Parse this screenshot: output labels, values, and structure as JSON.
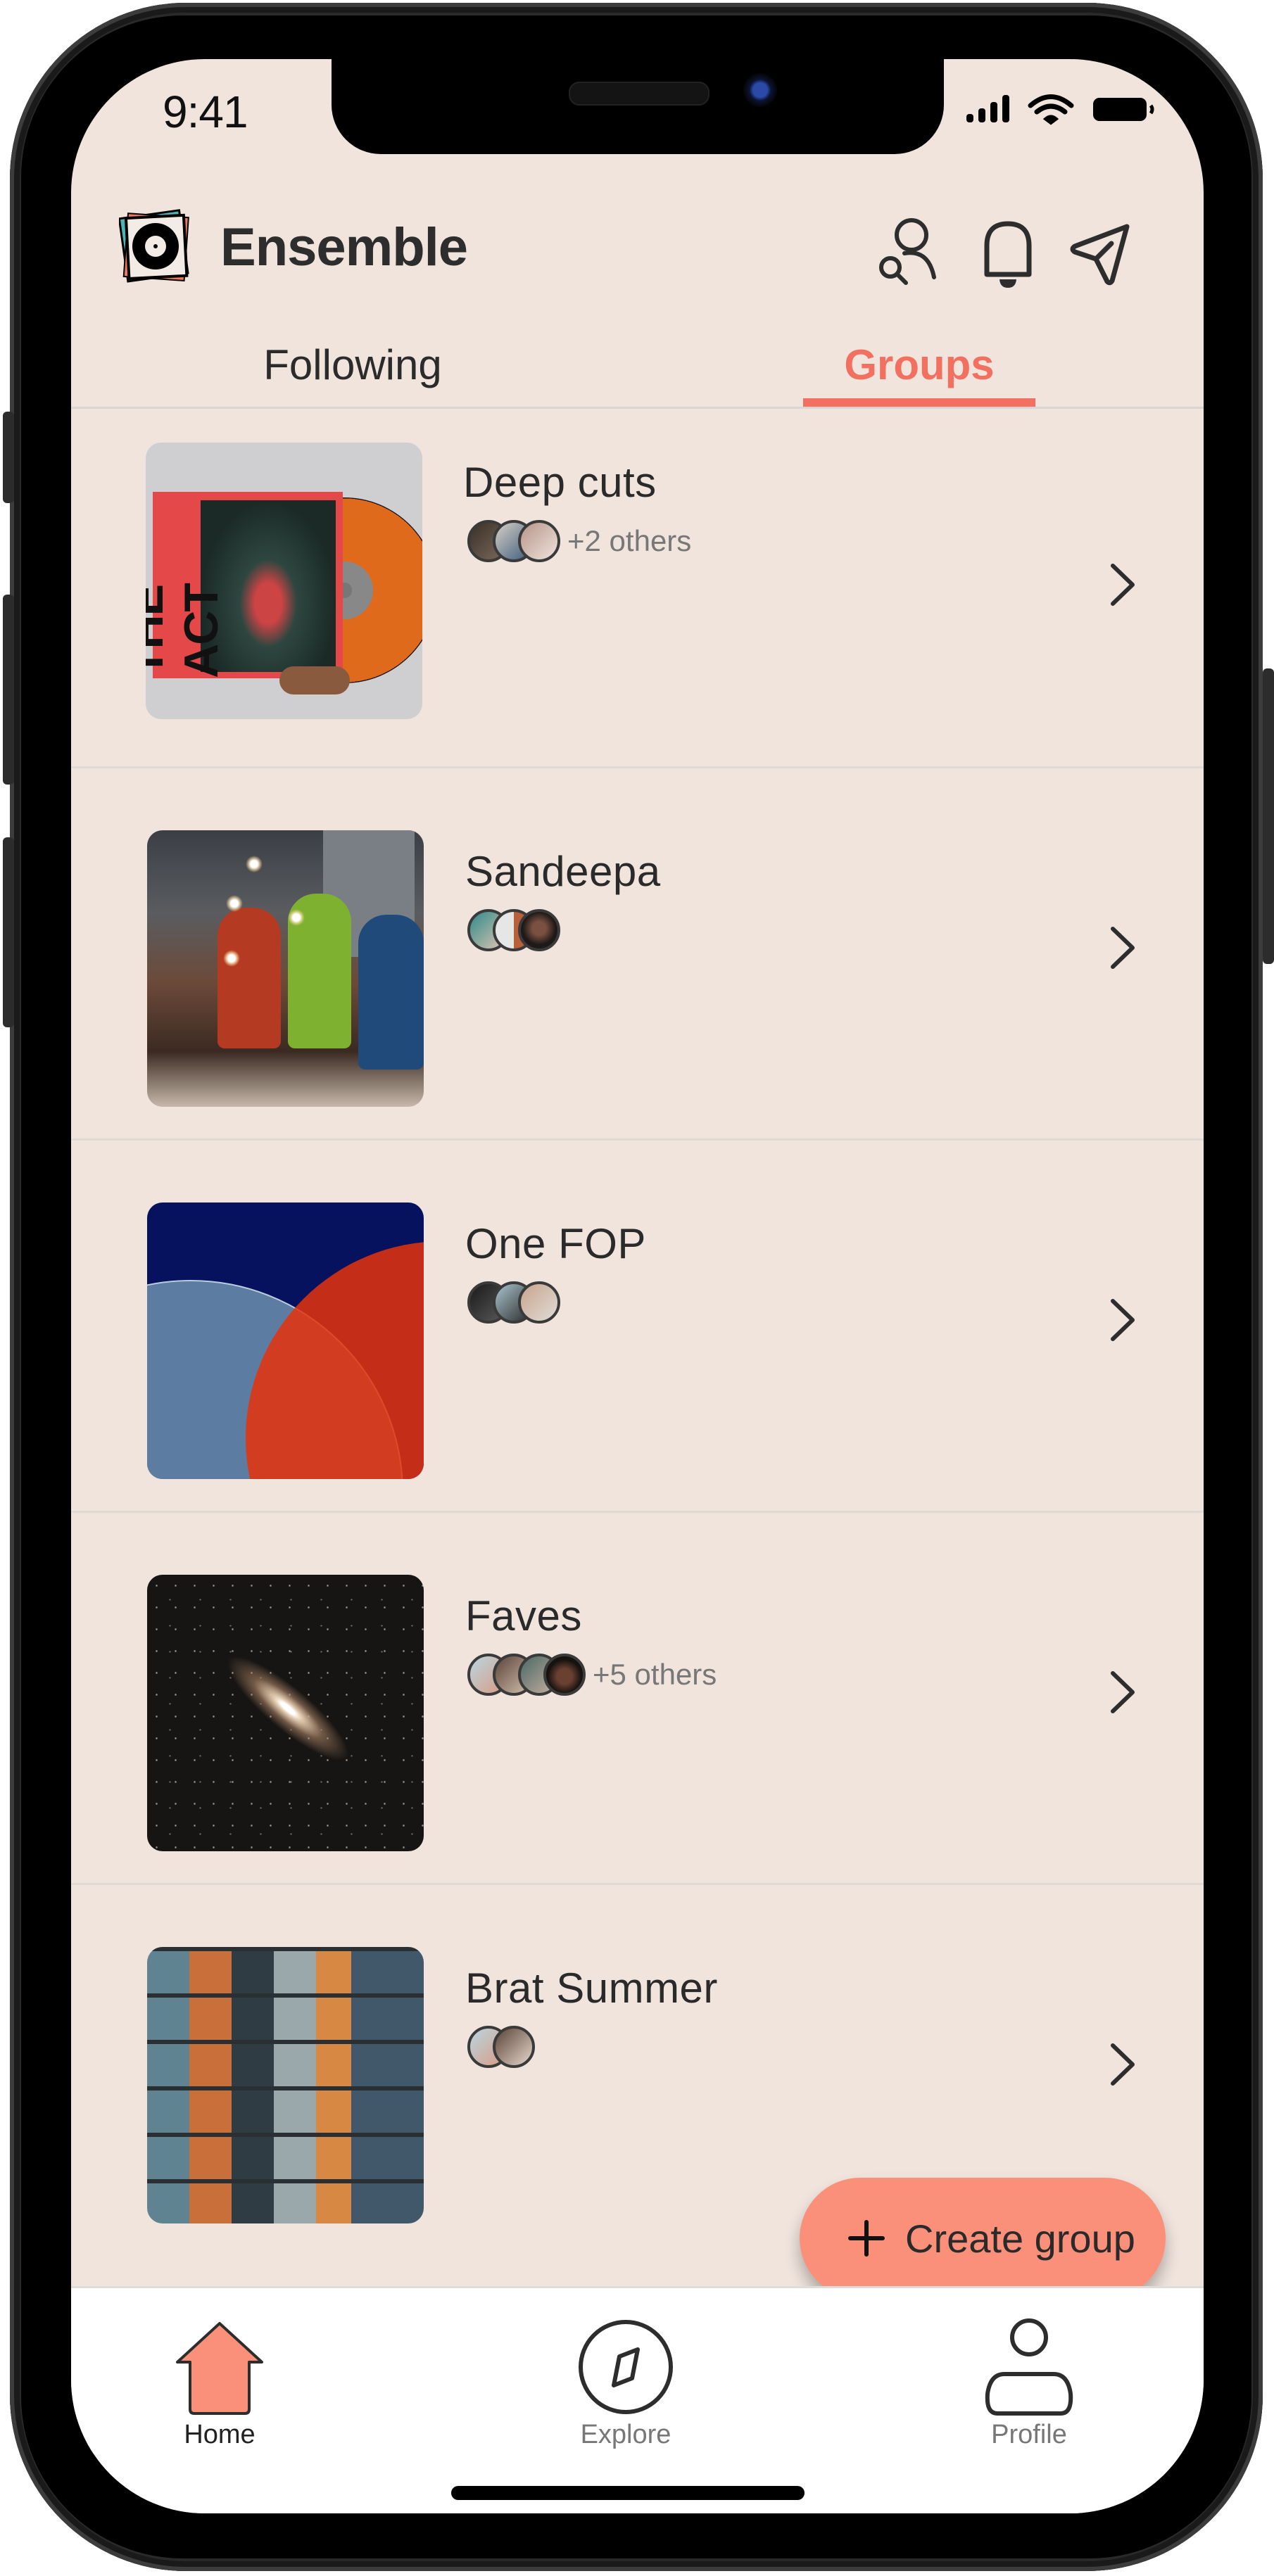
{
  "status_bar": {
    "time": "9:41",
    "icons": [
      "cellular-signal-icon",
      "wifi-icon",
      "battery-icon"
    ]
  },
  "header": {
    "app_name": "Ensemble",
    "logo": "vinyl-record-logo",
    "actions": [
      {
        "id": "find-people",
        "icon": "user-search-icon"
      },
      {
        "id": "notifications",
        "icon": "bell-icon"
      },
      {
        "id": "messages",
        "icon": "send-paper-plane-icon"
      }
    ]
  },
  "tabs": [
    {
      "label": "Following",
      "active": false
    },
    {
      "label": "Groups",
      "active": true
    }
  ],
  "groups": [
    {
      "name": "Deep cuts",
      "member_avatars": 3,
      "others_label": "+2 others",
      "cover": "vinyl album held in hand"
    },
    {
      "name": "Sandeepa",
      "member_avatars": 3,
      "others_label": "",
      "cover": "friends with sparklers on rooftop"
    },
    {
      "name": "One FOP",
      "member_avatars": 3,
      "others_label": "",
      "cover": "blue and red translucent vinyl records"
    },
    {
      "name": "Faves",
      "member_avatars": 4,
      "others_label": "+5 others",
      "cover": "galaxy in starfield"
    },
    {
      "name": "Brat Summer",
      "member_avatars": 2,
      "others_label": "",
      "cover": "record store shelves"
    }
  ],
  "fab": {
    "label": "Create group",
    "icon": "plus-icon"
  },
  "bottom_nav": [
    {
      "label": "Home",
      "icon": "home-icon",
      "active": true
    },
    {
      "label": "Explore",
      "icon": "compass-icon",
      "active": false
    },
    {
      "label": "Profile",
      "icon": "user-icon",
      "active": false
    }
  ],
  "colors": {
    "accent": "#f2705f",
    "fab": "#fb907a",
    "background": "#f0e4dd",
    "text": "#2a2a2a",
    "nav_background": "#ffffff"
  }
}
